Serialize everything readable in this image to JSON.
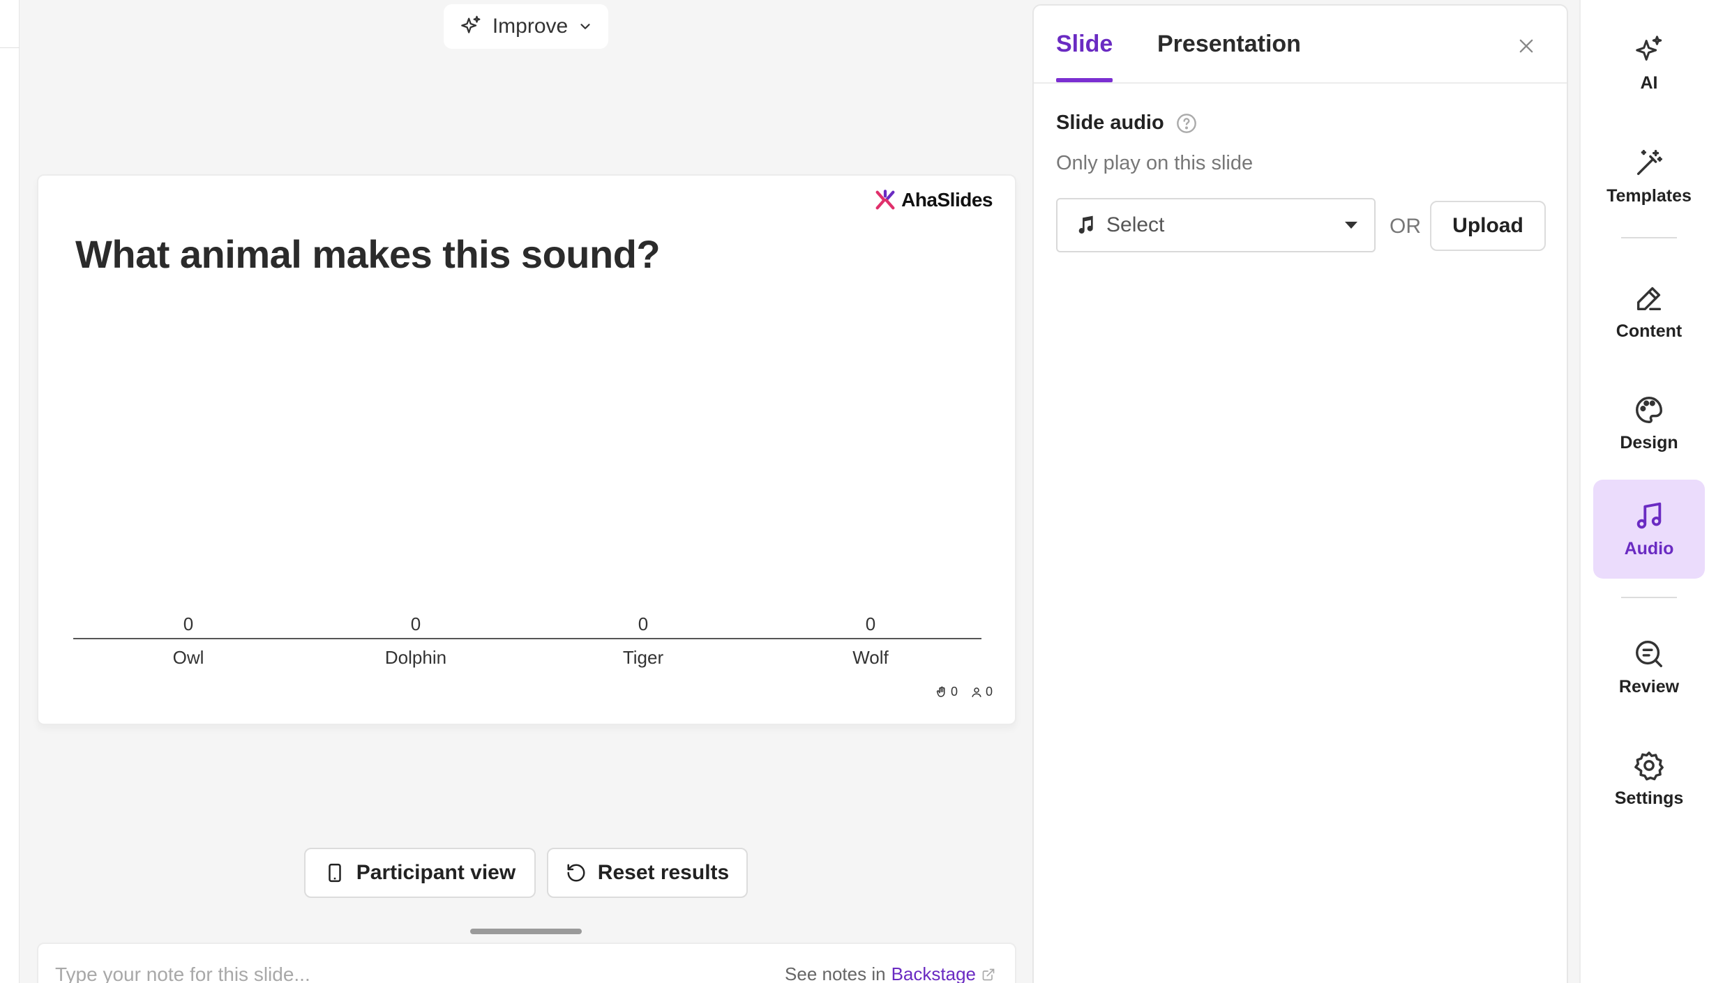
{
  "toolbar": {
    "improve_label": "Improve"
  },
  "slide": {
    "brand": "AhaSlides",
    "title": "What animal makes this sound?",
    "footer": {
      "reactions": "0",
      "participants": "0"
    }
  },
  "chart_data": {
    "type": "bar",
    "categories": [
      "Owl",
      "Dolphin",
      "Tiger",
      "Wolf"
    ],
    "values": [
      0,
      0,
      0,
      0
    ],
    "title": "What animal makes this sound?",
    "xlabel": "",
    "ylabel": ""
  },
  "actions": {
    "participant_view": "Participant view",
    "reset_results": "Reset results"
  },
  "notes": {
    "placeholder": "Type your note for this slide...",
    "see_notes_prefix": "See notes in",
    "backstage_link": "Backstage"
  },
  "panel": {
    "tabs": [
      {
        "label": "Slide",
        "active": true
      },
      {
        "label": "Presentation",
        "active": false
      }
    ],
    "slide_audio": {
      "label": "Slide audio",
      "sublabel": "Only play on this slide",
      "select_value": "Select",
      "or": "OR",
      "upload": "Upload"
    }
  },
  "rail": {
    "items": [
      {
        "label": "AI",
        "icon": "sparkle-icon"
      },
      {
        "label": "Templates",
        "icon": "magic-wand-icon"
      },
      {
        "label": "Content",
        "icon": "pencil-icon"
      },
      {
        "label": "Design",
        "icon": "palette-icon"
      },
      {
        "label": "Audio",
        "icon": "music-note-icon",
        "active": true
      },
      {
        "label": "Review",
        "icon": "review-icon"
      },
      {
        "label": "Settings",
        "icon": "gear-icon"
      }
    ]
  },
  "colors": {
    "accent": "#6a2bc2",
    "accent_bg": "#ebdcfc",
    "brand_pink": "#e0306b"
  }
}
